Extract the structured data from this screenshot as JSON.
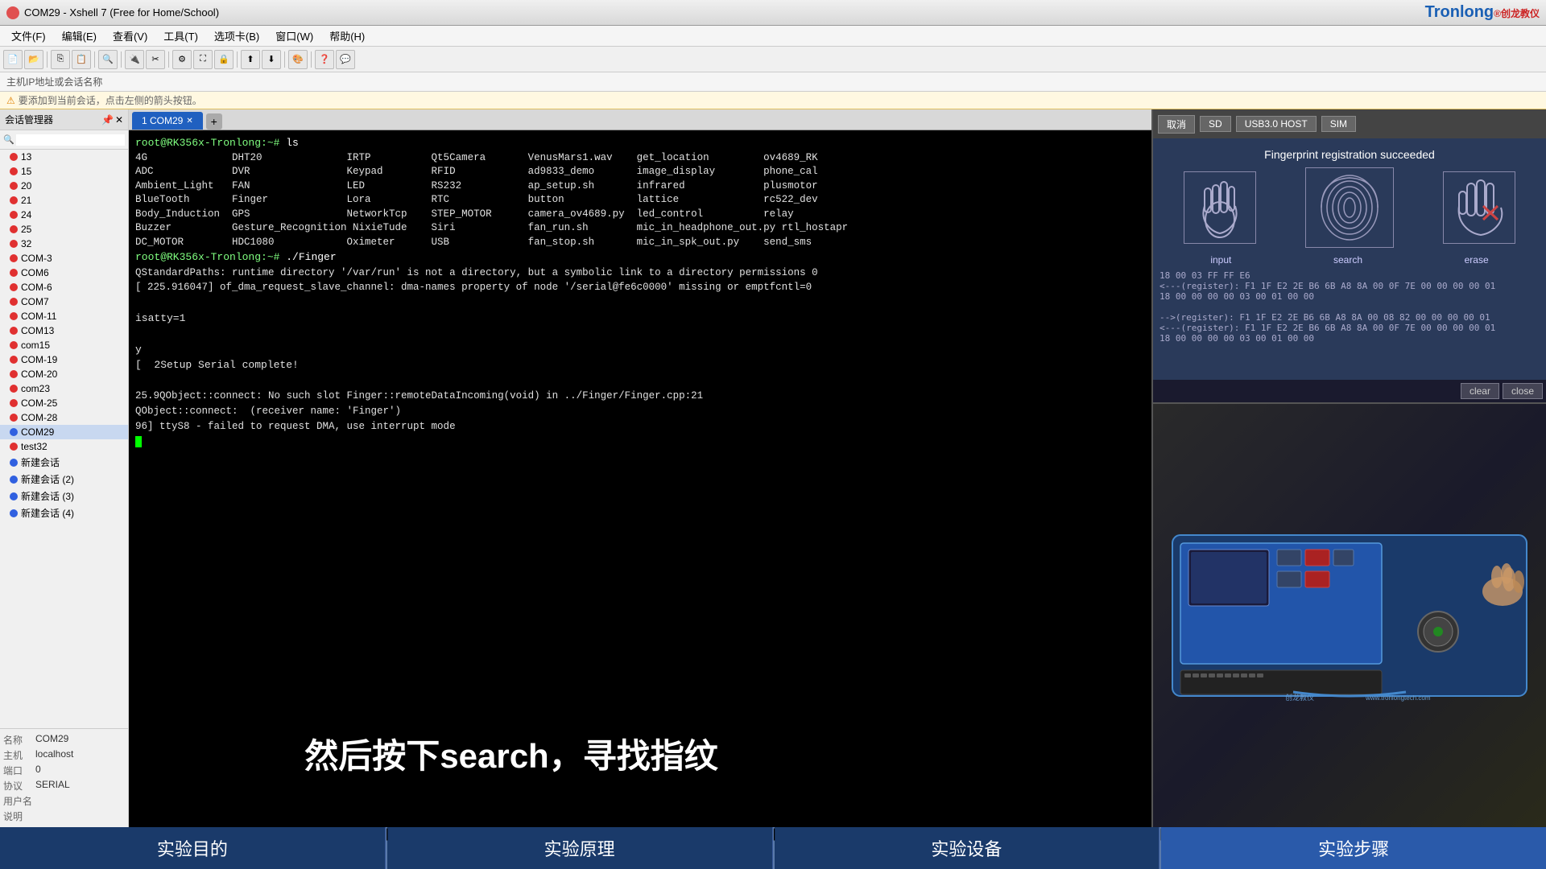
{
  "app": {
    "title": "COM29 - Xshell 7 (Free for Home/School)",
    "brand": "Tronlong",
    "brand_chinese": "®创龙教仪"
  },
  "menubar": {
    "items": [
      "文件(F)",
      "编辑(E)",
      "查看(V)",
      "工具(T)",
      "选项卡(B)",
      "窗口(W)",
      "帮助(H)"
    ]
  },
  "addressbar": {
    "text": "主机IP地址或会话名称"
  },
  "hintbar": {
    "text": "要添加到当前会话，点击左侧的箭头按钮。"
  },
  "session_manager": {
    "title": "会话管理器",
    "sessions": [
      {
        "id": "13",
        "type": "red"
      },
      {
        "id": "15",
        "type": "red"
      },
      {
        "id": "20",
        "type": "red"
      },
      {
        "id": "21",
        "type": "red"
      },
      {
        "id": "24",
        "type": "red"
      },
      {
        "id": "25",
        "type": "red"
      },
      {
        "id": "32",
        "type": "red"
      },
      {
        "id": "COM-3",
        "type": "red"
      },
      {
        "id": "COM6",
        "type": "red"
      },
      {
        "id": "COM-6",
        "type": "red"
      },
      {
        "id": "COM7",
        "type": "red"
      },
      {
        "id": "COM-11",
        "type": "red"
      },
      {
        "id": "COM13",
        "type": "red"
      },
      {
        "id": "com15",
        "type": "red"
      },
      {
        "id": "COM-19",
        "type": "red"
      },
      {
        "id": "COM-20",
        "type": "red"
      },
      {
        "id": "com23",
        "type": "red"
      },
      {
        "id": "COM-25",
        "type": "red"
      },
      {
        "id": "COM-28",
        "type": "red"
      },
      {
        "id": "COM29",
        "type": "blue",
        "active": true
      },
      {
        "id": "test32",
        "type": "red"
      },
      {
        "id": "新建会话",
        "type": "blue"
      },
      {
        "id": "新建会话 (2)",
        "type": "blue"
      },
      {
        "id": "新建会话 (3)",
        "type": "blue"
      },
      {
        "id": "新建会话 (4)",
        "type": "blue"
      }
    ],
    "info": {
      "name_label": "名称",
      "name_value": "COM29",
      "host_label": "主机",
      "host_value": "localhost",
      "port_label": "端口",
      "port_value": "0",
      "protocol_label": "协议",
      "protocol_value": "SERIAL",
      "user_label": "用户名",
      "user_value": "",
      "note_label": "说明",
      "note_value": ""
    }
  },
  "tab": {
    "label": "1 COM29",
    "add_label": "+"
  },
  "terminal": {
    "prompt1": "root@RK356x-Tronlong:~# ",
    "cmd1": "ls",
    "ls_col1": [
      "4G",
      "ADC",
      "Ambient_Light",
      "BlueTooth",
      "Body_Induction",
      "Buzzer",
      "DC_MOTOR"
    ],
    "ls_col2": [
      "DHT20",
      "DVR",
      "FAN",
      "Finger",
      "GPS",
      "Gesture_Recognition",
      "HDC1080"
    ],
    "ls_col3": [
      "IRTP",
      "Keypad",
      "LED",
      "Lora",
      "NetworkTcp",
      "NixieTude",
      "Oximeter"
    ],
    "ls_col4": [
      "Qt5Camera",
      "RFID",
      "RS232",
      "RTC",
      "STEP_MOTOR",
      "Siri",
      "USB"
    ],
    "ls_col5": [
      "VenusMars1.wav",
      "ad9833_demo",
      "ap_setup.sh",
      "button",
      "camera_ov4689.py",
      "fan_run.sh",
      "fan_stop.sh"
    ],
    "ls_col6": [
      "get_location",
      "image_display",
      "infrared",
      "lattice",
      "led_control",
      "mic_in_headphone_out.py",
      "mic_in_spk_out.py"
    ],
    "ls_col7": [
      "ov4689_RK",
      "phone_cal",
      "plusmoto",
      "rc522_de",
      "relay",
      "rtl_host",
      "send_sms"
    ],
    "prompt2": "root@RK356x-Tronlong:~# ",
    "cmd2": "./Finger",
    "lines": [
      "QStandardPaths: runtime directory '/var/run' is not a directory, but a symbolic link to a directory permissions 0",
      "[ 225.916047] of_dma_request_slave_channel: dma-names property of node '/serial@fe6c0000' missing or emptfcntl=0",
      "",
      "isatty=1",
      "",
      "y",
      "[  2Setup Serial complete!",
      "",
      "25.9QObject::connect: No such slot Finger::remoteDataIncoming(void) in ../Finger/Finger.cpp:21",
      "QObject::connect:  (receiver name: 'Finger')",
      "96] ttyS8 - failed to request DMA, use interrupt mode"
    ]
  },
  "right_panel": {
    "strip_buttons": [
      "取消",
      "SD",
      "USB3.0 HOST",
      "SIM"
    ],
    "fingerprint": {
      "title": "Fingerprint registration succeeded",
      "labels": [
        "input",
        "search",
        "erase"
      ],
      "hex_lines": [
        "18 00 03 FF FF E6",
        "<---(register): F1 1F E2 2E B6 6B A8 8A 00 0F 7E 00 00 00 00 01",
        "18 00 00 00 00 03 00 01 00 00",
        "",
        "-->(register): F1 1F E2 2E B6 6B A8 8A 00 08 82 00 00 00 00 01",
        "<---(register): F1 1F E2 2E B6 6B A8 8A 00 0F 7E 00 00 00 00 01",
        "18 00 00 00 00 03 00 01 00 00"
      ],
      "buttons": [
        "clear",
        "close"
      ]
    }
  },
  "bottom_tabs": [
    {
      "label": "实验目的",
      "active": false
    },
    {
      "label": "实验原理",
      "active": false
    },
    {
      "label": "实验设备",
      "active": false
    },
    {
      "label": "实验步骤",
      "active": true
    }
  ],
  "subtitle": {
    "text": "然后按下search，寻找指纹"
  }
}
